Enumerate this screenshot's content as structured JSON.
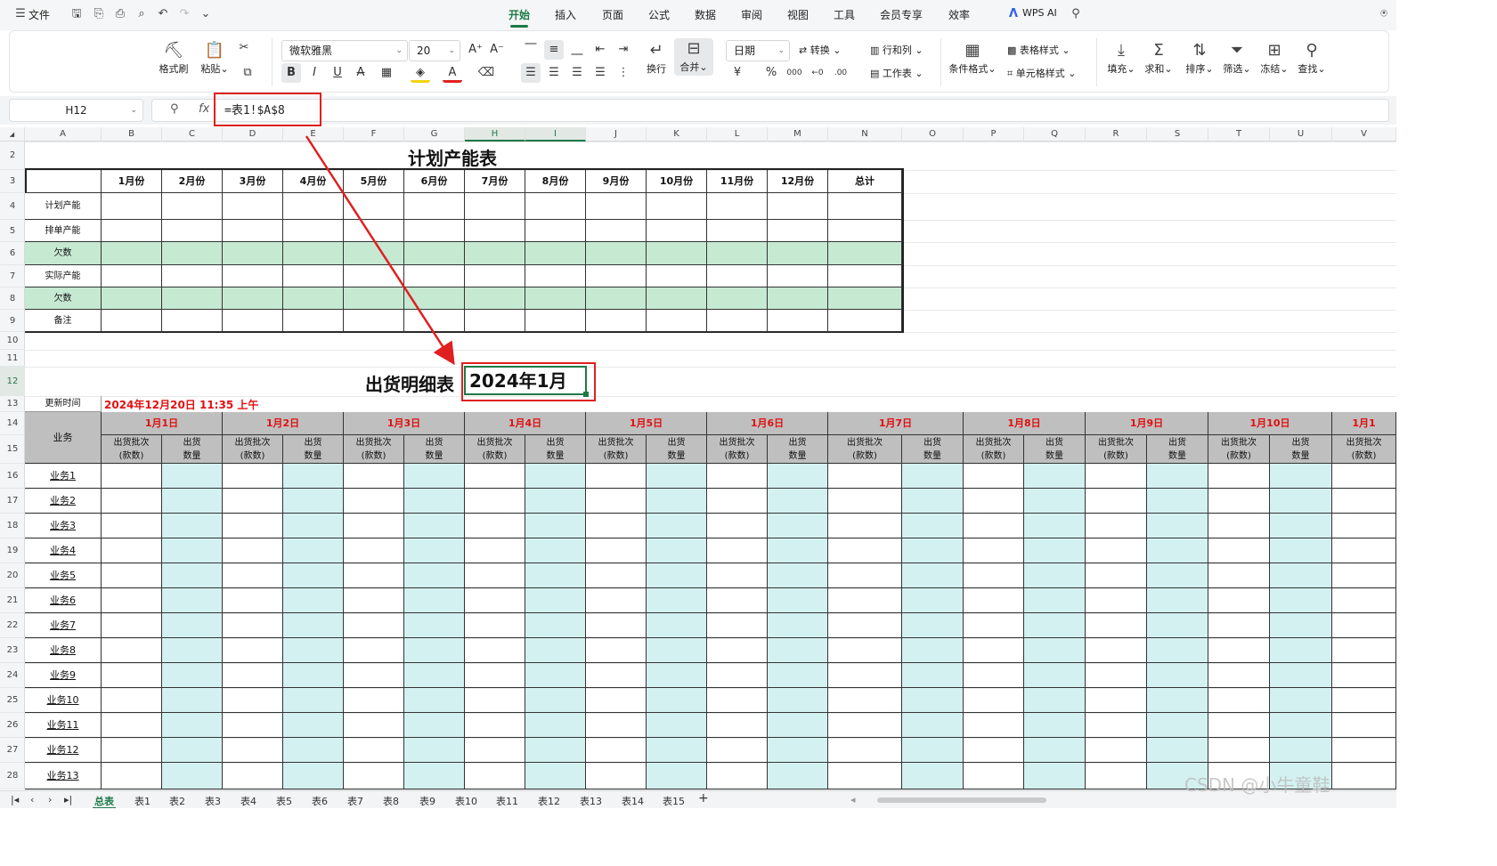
{
  "menu": {
    "file": "文件",
    "tabs": [
      "开始",
      "插入",
      "页面",
      "公式",
      "数据",
      "审阅",
      "视图",
      "工具",
      "会员专享",
      "效率"
    ],
    "active_tab": "开始",
    "wps_ai": "WPS AI"
  },
  "ribbon": {
    "format_painter": "格式刷",
    "paste": "粘贴",
    "font_name": "微软雅黑",
    "font_size": "20",
    "wrap": "换行",
    "merge": "合并",
    "number_format": "日期",
    "convert": "转换",
    "row_col": "行和列",
    "worksheet": "工作表",
    "cond_format": "条件格式",
    "table_style": "表格样式",
    "cell_style": "单元格样式",
    "fill": "填充",
    "sum": "求和",
    "sort": "排序",
    "filter": "筛选",
    "freeze": "冻结",
    "find": "查找"
  },
  "formula_bar": {
    "name_box": "H12",
    "fx": "fx",
    "formula": "=表1!$A$8"
  },
  "columns": [
    "A",
    "B",
    "C",
    "D",
    "E",
    "F",
    "G",
    "H",
    "I",
    "J",
    "K",
    "L",
    "M",
    "N",
    "O",
    "P",
    "Q",
    "R",
    "S",
    "T",
    "U",
    "V"
  ],
  "rows": [
    "2",
    "3",
    "4",
    "5",
    "6",
    "7",
    "8",
    "9",
    "10",
    "11",
    "12",
    "13",
    "14",
    "15",
    "16",
    "17",
    "18",
    "19",
    "20",
    "21",
    "22",
    "23",
    "24",
    "25",
    "26",
    "27",
    "28"
  ],
  "plan_table": {
    "title": "计划产能表",
    "months": [
      "1月份",
      "2月份",
      "3月份",
      "4月份",
      "5月份",
      "6月份",
      "7月份",
      "8月份",
      "9月份",
      "10月份",
      "11月份",
      "12月份",
      "总计"
    ],
    "row_labels": [
      "计划产能",
      "排单产能",
      "欠数",
      "实际产能",
      "欠数",
      "备注"
    ],
    "highlight_color": "#c6e9d2"
  },
  "shipment": {
    "title": "出货明细表",
    "month_cell": "2024年1月",
    "update_label": "更新时间",
    "update_value": "2024年12月20日 11:35 上午",
    "business_header": "业务",
    "days": [
      "1月1日",
      "1月2日",
      "1月3日",
      "1月4日",
      "1月5日",
      "1月6日",
      "1月7日",
      "1月8日",
      "1月9日",
      "1月10日",
      "1月1"
    ],
    "sub_a": [
      "出货批次",
      "(款数)"
    ],
    "sub_b": [
      "出货",
      "数量"
    ],
    "businesses": [
      "业务1",
      "业务2",
      "业务3",
      "业务4",
      "业务5",
      "业务6",
      "业务7",
      "业务8",
      "业务9",
      "业务10",
      "业务11",
      "业务12",
      "业务13"
    ],
    "header_bg": "#bfbfbf",
    "qty_bg": "#d4f1f1",
    "date_color": "#e01010"
  },
  "sheet_tabs": [
    "总表",
    "表1",
    "表2",
    "表3",
    "表4",
    "表5",
    "表6",
    "表7",
    "表8",
    "表9",
    "表10",
    "表11",
    "表12",
    "表13",
    "表14",
    "表15"
  ],
  "active_sheet": "总表",
  "watermark": "CSDN @小牛童鞋"
}
